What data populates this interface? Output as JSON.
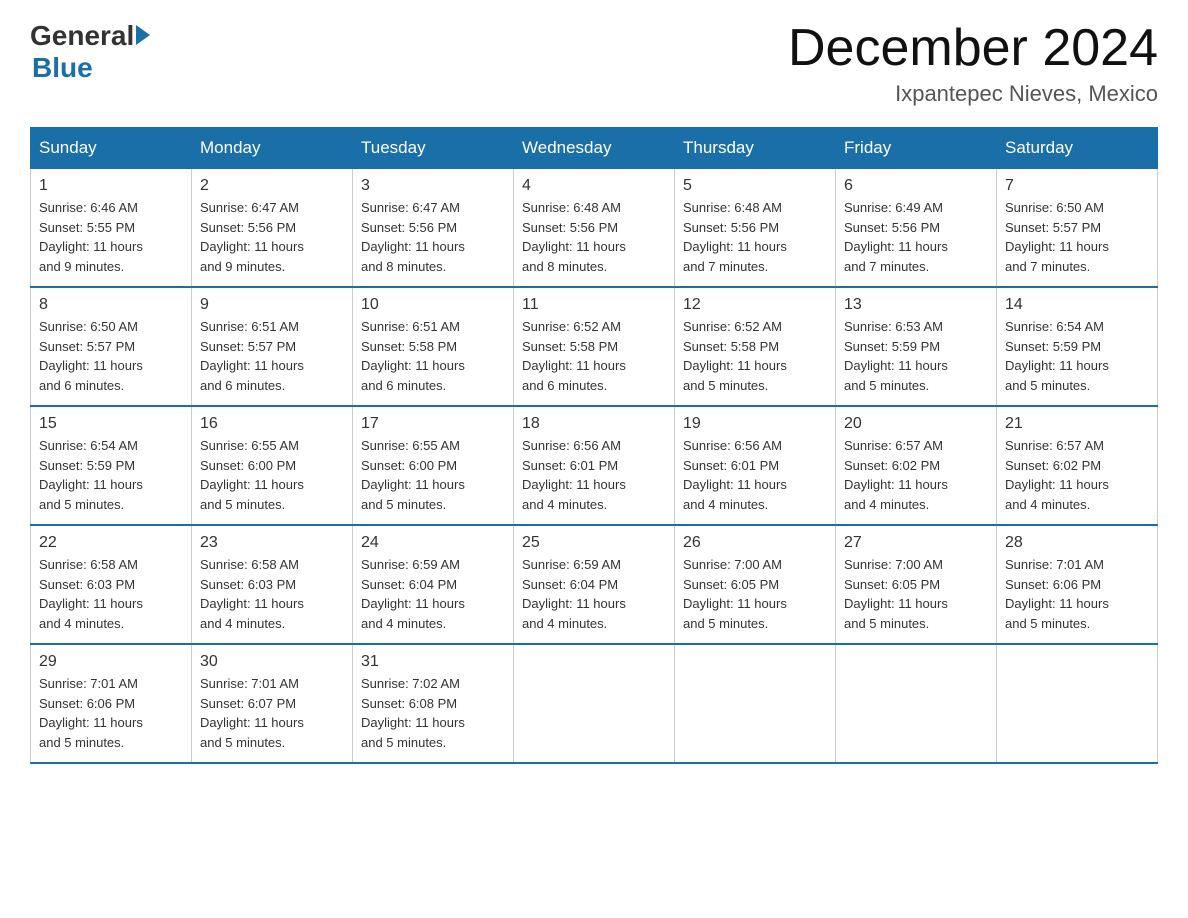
{
  "header": {
    "logo_general": "General",
    "logo_blue": "Blue",
    "month_title": "December 2024",
    "location": "Ixpantepec Nieves, Mexico"
  },
  "days_of_week": [
    "Sunday",
    "Monday",
    "Tuesday",
    "Wednesday",
    "Thursday",
    "Friday",
    "Saturday"
  ],
  "weeks": [
    [
      {
        "day": "1",
        "sunrise": "6:46 AM",
        "sunset": "5:55 PM",
        "daylight": "11 hours and 9 minutes."
      },
      {
        "day": "2",
        "sunrise": "6:47 AM",
        "sunset": "5:56 PM",
        "daylight": "11 hours and 9 minutes."
      },
      {
        "day": "3",
        "sunrise": "6:47 AM",
        "sunset": "5:56 PM",
        "daylight": "11 hours and 8 minutes."
      },
      {
        "day": "4",
        "sunrise": "6:48 AM",
        "sunset": "5:56 PM",
        "daylight": "11 hours and 8 minutes."
      },
      {
        "day": "5",
        "sunrise": "6:48 AM",
        "sunset": "5:56 PM",
        "daylight": "11 hours and 7 minutes."
      },
      {
        "day": "6",
        "sunrise": "6:49 AM",
        "sunset": "5:56 PM",
        "daylight": "11 hours and 7 minutes."
      },
      {
        "day": "7",
        "sunrise": "6:50 AM",
        "sunset": "5:57 PM",
        "daylight": "11 hours and 7 minutes."
      }
    ],
    [
      {
        "day": "8",
        "sunrise": "6:50 AM",
        "sunset": "5:57 PM",
        "daylight": "11 hours and 6 minutes."
      },
      {
        "day": "9",
        "sunrise": "6:51 AM",
        "sunset": "5:57 PM",
        "daylight": "11 hours and 6 minutes."
      },
      {
        "day": "10",
        "sunrise": "6:51 AM",
        "sunset": "5:58 PM",
        "daylight": "11 hours and 6 minutes."
      },
      {
        "day": "11",
        "sunrise": "6:52 AM",
        "sunset": "5:58 PM",
        "daylight": "11 hours and 6 minutes."
      },
      {
        "day": "12",
        "sunrise": "6:52 AM",
        "sunset": "5:58 PM",
        "daylight": "11 hours and 5 minutes."
      },
      {
        "day": "13",
        "sunrise": "6:53 AM",
        "sunset": "5:59 PM",
        "daylight": "11 hours and 5 minutes."
      },
      {
        "day": "14",
        "sunrise": "6:54 AM",
        "sunset": "5:59 PM",
        "daylight": "11 hours and 5 minutes."
      }
    ],
    [
      {
        "day": "15",
        "sunrise": "6:54 AM",
        "sunset": "5:59 PM",
        "daylight": "11 hours and 5 minutes."
      },
      {
        "day": "16",
        "sunrise": "6:55 AM",
        "sunset": "6:00 PM",
        "daylight": "11 hours and 5 minutes."
      },
      {
        "day": "17",
        "sunrise": "6:55 AM",
        "sunset": "6:00 PM",
        "daylight": "11 hours and 5 minutes."
      },
      {
        "day": "18",
        "sunrise": "6:56 AM",
        "sunset": "6:01 PM",
        "daylight": "11 hours and 4 minutes."
      },
      {
        "day": "19",
        "sunrise": "6:56 AM",
        "sunset": "6:01 PM",
        "daylight": "11 hours and 4 minutes."
      },
      {
        "day": "20",
        "sunrise": "6:57 AM",
        "sunset": "6:02 PM",
        "daylight": "11 hours and 4 minutes."
      },
      {
        "day": "21",
        "sunrise": "6:57 AM",
        "sunset": "6:02 PM",
        "daylight": "11 hours and 4 minutes."
      }
    ],
    [
      {
        "day": "22",
        "sunrise": "6:58 AM",
        "sunset": "6:03 PM",
        "daylight": "11 hours and 4 minutes."
      },
      {
        "day": "23",
        "sunrise": "6:58 AM",
        "sunset": "6:03 PM",
        "daylight": "11 hours and 4 minutes."
      },
      {
        "day": "24",
        "sunrise": "6:59 AM",
        "sunset": "6:04 PM",
        "daylight": "11 hours and 4 minutes."
      },
      {
        "day": "25",
        "sunrise": "6:59 AM",
        "sunset": "6:04 PM",
        "daylight": "11 hours and 4 minutes."
      },
      {
        "day": "26",
        "sunrise": "7:00 AM",
        "sunset": "6:05 PM",
        "daylight": "11 hours and 5 minutes."
      },
      {
        "day": "27",
        "sunrise": "7:00 AM",
        "sunset": "6:05 PM",
        "daylight": "11 hours and 5 minutes."
      },
      {
        "day": "28",
        "sunrise": "7:01 AM",
        "sunset": "6:06 PM",
        "daylight": "11 hours and 5 minutes."
      }
    ],
    [
      {
        "day": "29",
        "sunrise": "7:01 AM",
        "sunset": "6:06 PM",
        "daylight": "11 hours and 5 minutes."
      },
      {
        "day": "30",
        "sunrise": "7:01 AM",
        "sunset": "6:07 PM",
        "daylight": "11 hours and 5 minutes."
      },
      {
        "day": "31",
        "sunrise": "7:02 AM",
        "sunset": "6:08 PM",
        "daylight": "11 hours and 5 minutes."
      },
      null,
      null,
      null,
      null
    ]
  ],
  "labels": {
    "sunrise_prefix": "Sunrise: ",
    "sunset_prefix": "Sunset: ",
    "daylight_prefix": "Daylight: "
  }
}
